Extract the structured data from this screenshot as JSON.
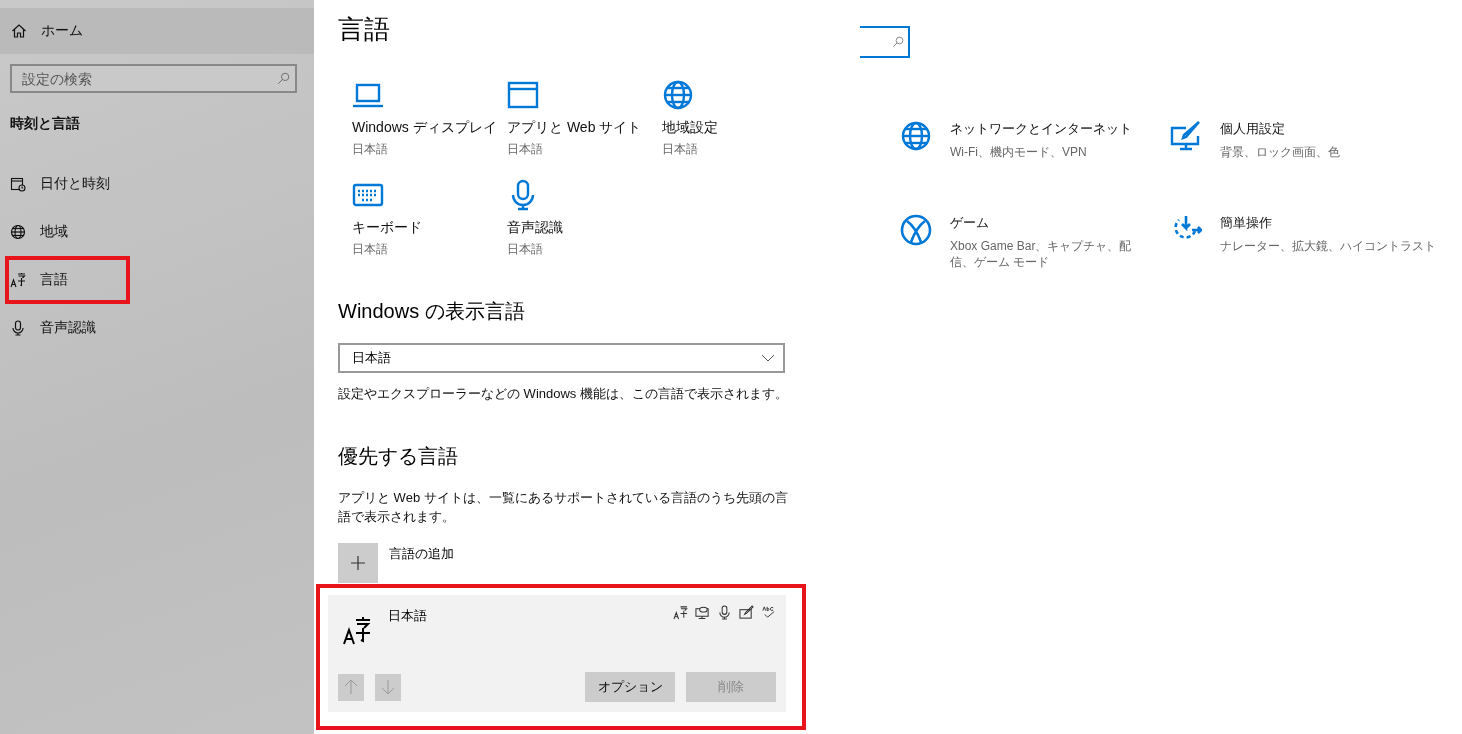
{
  "sidebar": {
    "home": {
      "label": "ホーム"
    },
    "search": {
      "placeholder": "設定の検索"
    },
    "section_title": "時刻と言語",
    "items": [
      {
        "label": "日付と時刻",
        "highlighted": false
      },
      {
        "label": "地域",
        "highlighted": false
      },
      {
        "label": "言語",
        "highlighted": true
      },
      {
        "label": "音声認識",
        "highlighted": false
      }
    ]
  },
  "language_page": {
    "title": "言語",
    "tiles": [
      {
        "label": "Windows ディスプレイ",
        "value": "日本語"
      },
      {
        "label": "アプリと Web サイト",
        "value": "日本語"
      },
      {
        "label": "地域設定",
        "value": "日本語"
      },
      {
        "label": "キーボード",
        "value": "日本語"
      },
      {
        "label": "音声認識",
        "value": "日本語"
      }
    ],
    "display_language": {
      "heading": "Windows の表示言語",
      "value": "日本語",
      "description": "設定やエクスプローラーなどの Windows 機能は、この言語で表示されます。"
    },
    "preferred": {
      "heading": "優先する言語",
      "description": "アプリと Web サイトは、一覧にあるサポートされている言語のうち先頭の言語で表示されます。",
      "add_label": "言語の追加",
      "languages": [
        {
          "name": "日本語",
          "highlighted": true,
          "move_up_disabled": true,
          "move_down_disabled": true,
          "buttons": [
            {
              "label": "オプション",
              "disabled": false
            },
            {
              "label": "削除",
              "disabled": true
            }
          ]
        }
      ]
    }
  },
  "settings_home": {
    "categories": [
      {
        "title": "ネットワークとインターネット",
        "subtitle": "Wi-Fi、機内モード、VPN"
      },
      {
        "title": "個人用設定",
        "subtitle": "背景、ロック画面、色"
      },
      {
        "title": "ゲーム",
        "subtitle": "Xbox Game Bar、キャプチャ、配信、ゲーム モード"
      },
      {
        "title": "簡単操作",
        "subtitle": "ナレーター、拡大鏡、ハイコントラスト"
      }
    ]
  }
}
